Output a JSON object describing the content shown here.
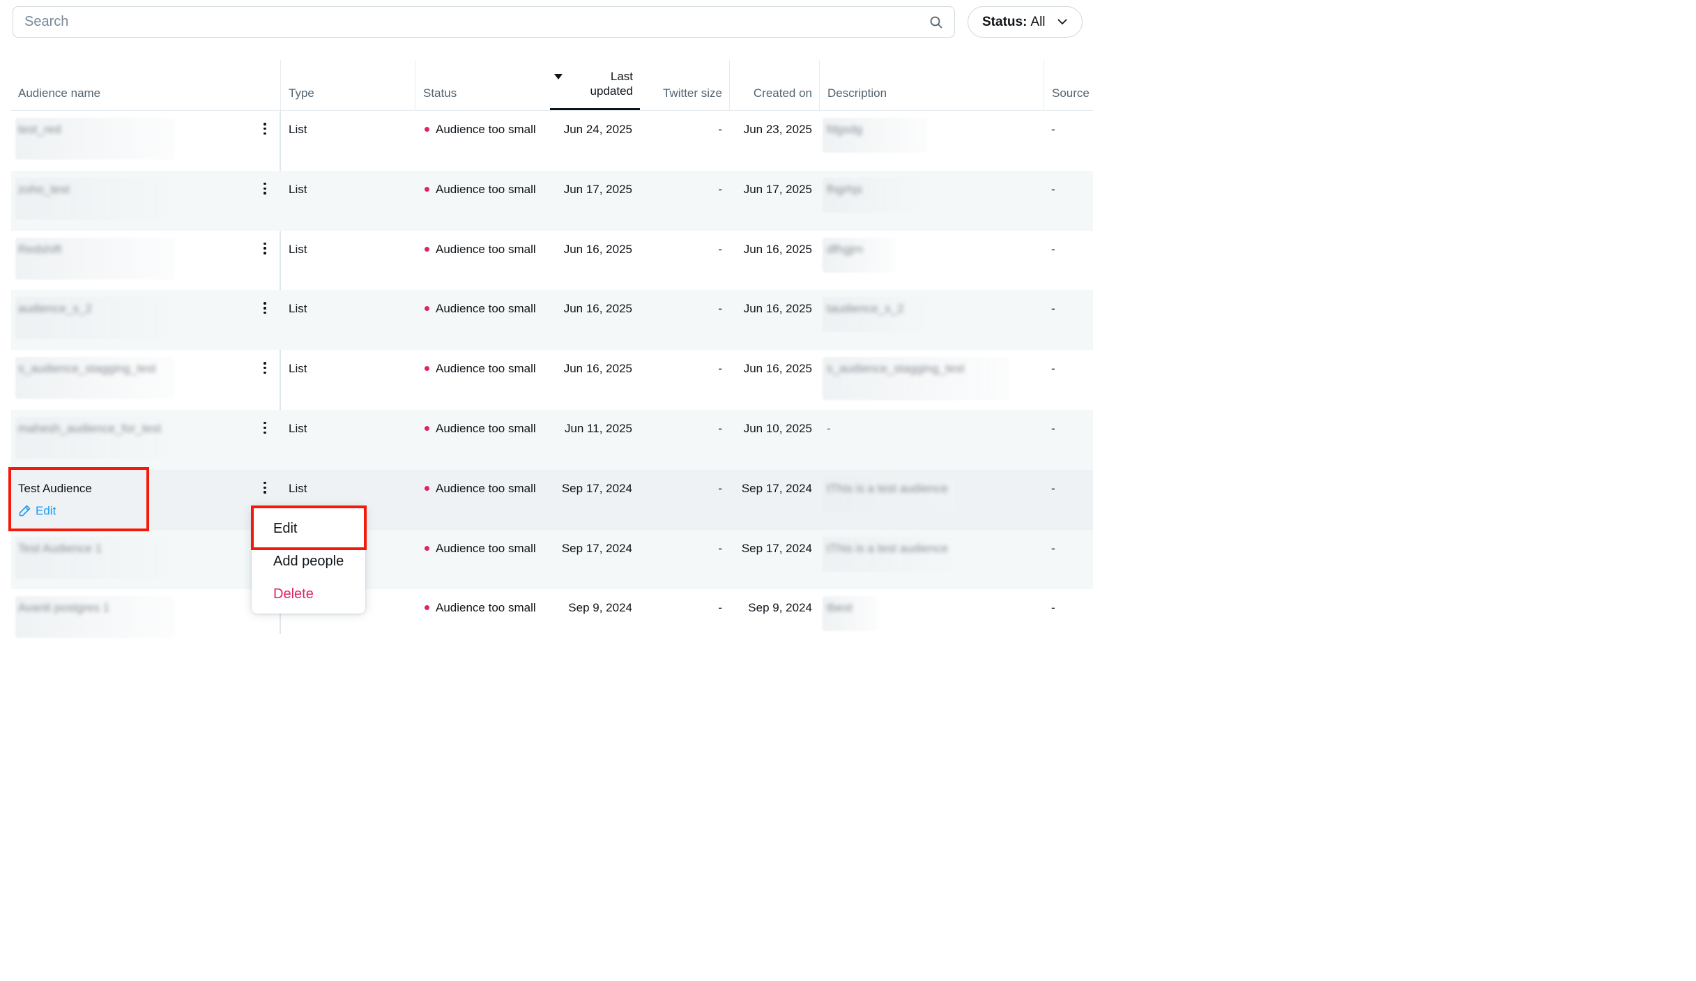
{
  "search": {
    "placeholder": "Search",
    "icon": "search-icon"
  },
  "status_filter": {
    "label": "Status:",
    "value": "All"
  },
  "table": {
    "headers": {
      "audience_name": "Audience name",
      "type": "Type",
      "status": "Status",
      "last_updated": "Last updated",
      "twitter_size": "Twitter size",
      "created_on": "Created on",
      "description": "Description",
      "source": "Source"
    },
    "rows": [
      {
        "name": "test_red",
        "type": "List",
        "status": "Audience too small",
        "last_updated": "Jun 24, 2025",
        "twitter_size": "-",
        "created_on": "Jun 23, 2025",
        "description": "fdgsdg",
        "source": "-"
      },
      {
        "name": "zoho_test",
        "type": "List",
        "status": "Audience too small",
        "last_updated": "Jun 17, 2025",
        "twitter_size": "-",
        "created_on": "Jun 17, 2025",
        "description": "fhgrhjs",
        "source": "-"
      },
      {
        "name": "Redshift",
        "type": "List",
        "status": "Audience too small",
        "last_updated": "Jun 16, 2025",
        "twitter_size": "-",
        "created_on": "Jun 16, 2025",
        "description": "dfhgjrn",
        "source": "-"
      },
      {
        "name": "audience_s_2",
        "type": "List",
        "status": "Audience too small",
        "last_updated": "Jun 16, 2025",
        "twitter_size": "-",
        "created_on": "Jun 16, 2025",
        "description": "taudience_s_2",
        "source": "-"
      },
      {
        "name": "s_audience_stagging_test",
        "type": "List",
        "status": "Audience too small",
        "last_updated": "Jun 16, 2025",
        "twitter_size": "-",
        "created_on": "Jun 16, 2025",
        "description": "s_audience_stagging_test",
        "source": "-"
      },
      {
        "name": "mahesh_audience_for_test",
        "type": "List",
        "status": "Audience too small",
        "last_updated": "Jun 11, 2025",
        "twitter_size": "-",
        "created_on": "Jun 10, 2025",
        "description": "-",
        "source": "-"
      },
      {
        "name": "Test Audience",
        "edit_label": "Edit",
        "type": "List",
        "status": "Audience too small",
        "last_updated": "Sep 17, 2024",
        "twitter_size": "-",
        "created_on": "Sep 17, 2024",
        "description": "tThis is a test audience",
        "source": "-"
      },
      {
        "name": "Test Audience 1",
        "type": "List",
        "status": "Audience too small",
        "last_updated": "Sep 17, 2024",
        "twitter_size": "-",
        "created_on": "Sep 17, 2024",
        "description": "tThis is a test audience",
        "source": "-"
      },
      {
        "name": "Avanti postgres 1",
        "type": "List",
        "status": "Audience too small",
        "last_updated": "Sep 9, 2024",
        "twitter_size": "-",
        "created_on": "Sep 9, 2024",
        "description": "tbest",
        "source": "-"
      }
    ]
  },
  "context_menu": {
    "items": [
      "Edit",
      "Add people",
      "Delete"
    ]
  },
  "colors": {
    "status_dot": "#e0245e",
    "link": "#1d9bf0",
    "danger": "#e0245e",
    "highlight": "#f31a0a"
  }
}
